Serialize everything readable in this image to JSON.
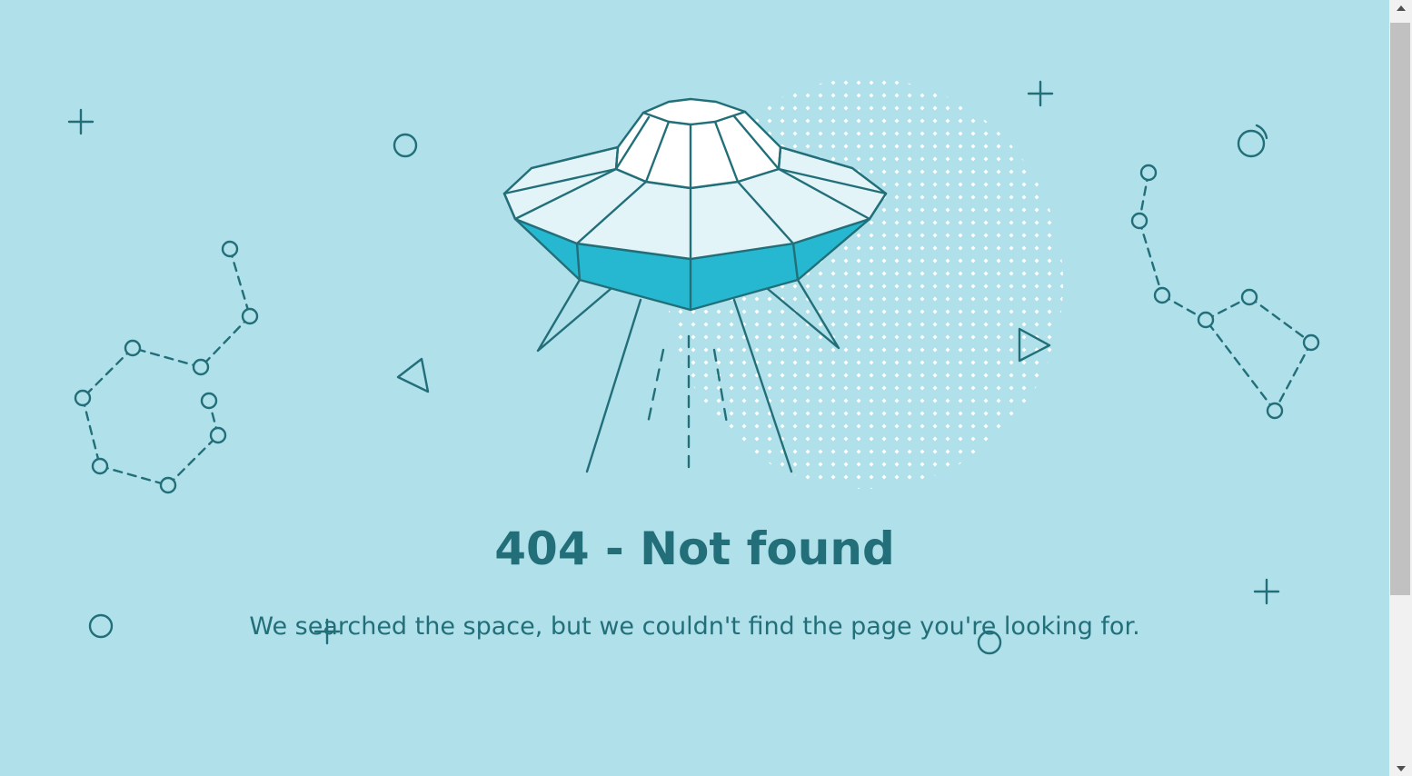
{
  "error": {
    "title": "404 - Not found",
    "message": "We searched the space, but we couldn't find the page you're looking for."
  },
  "illustration": {
    "icon": "ufo-icon",
    "decorations": [
      "constellation-icon",
      "plus-icon",
      "circle-icon",
      "triangle-icon"
    ]
  },
  "colors": {
    "background": "#b0e0e9",
    "ink": "#226f79",
    "ufo_hull": "#25b8d0",
    "ufo_panel": "#e3f4f8"
  }
}
